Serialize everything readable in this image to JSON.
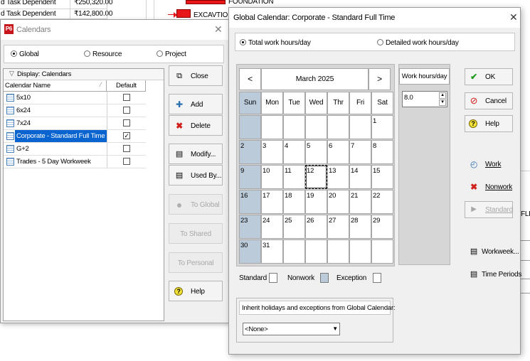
{
  "background": {
    "rows": [
      {
        "prefix": "d",
        "type": "Task Dependent",
        "amount": "₹250,320.00"
      },
      {
        "prefix": "d",
        "type": "Task Dependent",
        "amount": "₹142,800.00"
      }
    ],
    "gantt_labels": [
      "FOUNDATION",
      "EXCAVTION"
    ],
    "edge_label": "FLR"
  },
  "calendars_dialog": {
    "title": "Calendars",
    "scope_options": [
      {
        "label": "Global",
        "selected": true
      },
      {
        "label": "Resource",
        "selected": false
      },
      {
        "label": "Project",
        "selected": false
      }
    ],
    "display_label": "Display: Calendars",
    "columns": [
      "Calendar Name",
      "Default"
    ],
    "rows": [
      {
        "name": "5x10",
        "default": false,
        "selected": false
      },
      {
        "name": "6x24",
        "default": false,
        "selected": false
      },
      {
        "name": "7x24",
        "default": false,
        "selected": false
      },
      {
        "name": "Corporate - Standard Full Time",
        "default": true,
        "selected": true
      },
      {
        "name": "G+2",
        "default": false,
        "selected": false
      },
      {
        "name": "Trades -  5 Day Workweek",
        "default": false,
        "selected": false
      }
    ],
    "buttons": {
      "close": "Close",
      "add": "Add",
      "delete": "Delete",
      "modify": "Modify...",
      "used_by": "Used By...",
      "to_global": "To Global",
      "to_shared": "To Shared",
      "to_personal": "To Personal",
      "help": "Help"
    }
  },
  "global_calendar_dialog": {
    "title": "Global Calendar: Corporate - Standard Full Time",
    "mode_options": [
      {
        "label": "Total work hours/day",
        "selected": true
      },
      {
        "label": "Detailed work hours/day",
        "selected": false
      }
    ],
    "month": {
      "label": "March 2025",
      "prev": "<",
      "next": ">",
      "day_headers": [
        "Sun",
        "Mon",
        "Tue",
        "Wed",
        "Thr",
        "Fri",
        "Sat"
      ],
      "weeks": [
        [
          "",
          "",
          "",
          "",
          "",
          "",
          "1"
        ],
        [
          "2",
          "3",
          "4",
          "5",
          "6",
          "7",
          "8"
        ],
        [
          "9",
          "10",
          "11",
          "12",
          "13",
          "14",
          "15"
        ],
        [
          "16",
          "17",
          "18",
          "19",
          "20",
          "21",
          "22"
        ],
        [
          "23",
          "24",
          "25",
          "26",
          "27",
          "28",
          "29"
        ],
        [
          "30",
          "31",
          "",
          "",
          "",
          "",
          ""
        ]
      ],
      "selected_day": "12"
    },
    "work_hours": {
      "label": "Work hours/day",
      "value": "8.0"
    },
    "legend": {
      "standard": "Standard",
      "nonwork": "Nonwork",
      "exception": "Exception"
    },
    "inherit": {
      "label": "Inherit holidays and exceptions from Global Calendar:",
      "value": "<None>"
    },
    "buttons": {
      "ok": "OK",
      "cancel": "Cancel",
      "help": "Help",
      "work": "Work",
      "nonwork": "Nonwork",
      "standard": "Standard",
      "workweek": "Workweek...",
      "time_periods": "Time Periods"
    },
    "colors": {
      "sunday": "#bccbda",
      "selected_row": "#0a64d0",
      "accent_red": "#e8171a"
    }
  }
}
